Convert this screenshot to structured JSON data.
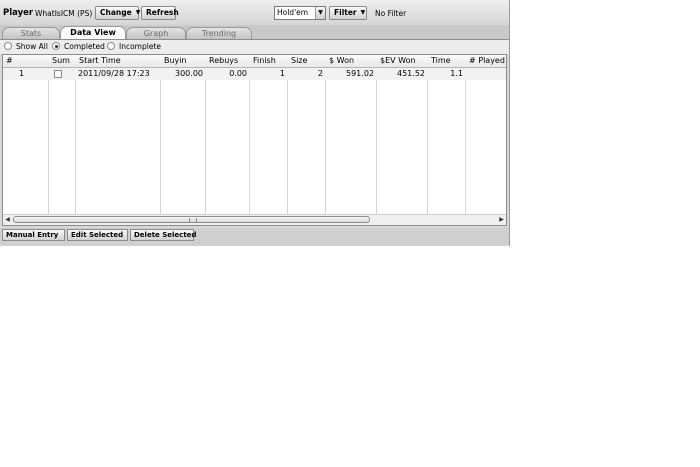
{
  "toolbar": {
    "player_label": "Player",
    "player_name": "WhatIsICM (PS)",
    "change_label": "Change",
    "refresh_label": "Refresh",
    "game_select": "Hold'em",
    "filter_label": "Filter",
    "filter_status": "No Filter"
  },
  "tabs": [
    {
      "label": "Stats",
      "active": false
    },
    {
      "label": "Data View",
      "active": true
    },
    {
      "label": "Graph",
      "active": false
    },
    {
      "label": "Trending",
      "active": false
    }
  ],
  "view_options": [
    {
      "label": "Show All",
      "selected": false
    },
    {
      "label": "Completed",
      "selected": true
    },
    {
      "label": "Incomplete",
      "selected": false
    }
  ],
  "table": {
    "columns": [
      "#",
      "Sum",
      "Start Time",
      "Buyin",
      "Rebuys",
      "Finish",
      "Size",
      "$ Won",
      "$EV Won",
      "Time",
      "# Played"
    ],
    "rows": [
      {
        "num": "1",
        "sum_checked": false,
        "start_time": "2011/09/28 17:23",
        "buyin": "300.00",
        "rebuys": "0.00",
        "finish": "1",
        "size": "2",
        "won": "591.02",
        "ev_won": "451.52",
        "time": "1.1"
      }
    ]
  },
  "actions": {
    "manual_entry": "Manual Entry",
    "edit_selected": "Edit Selected",
    "delete_selected": "Delete Selected"
  }
}
